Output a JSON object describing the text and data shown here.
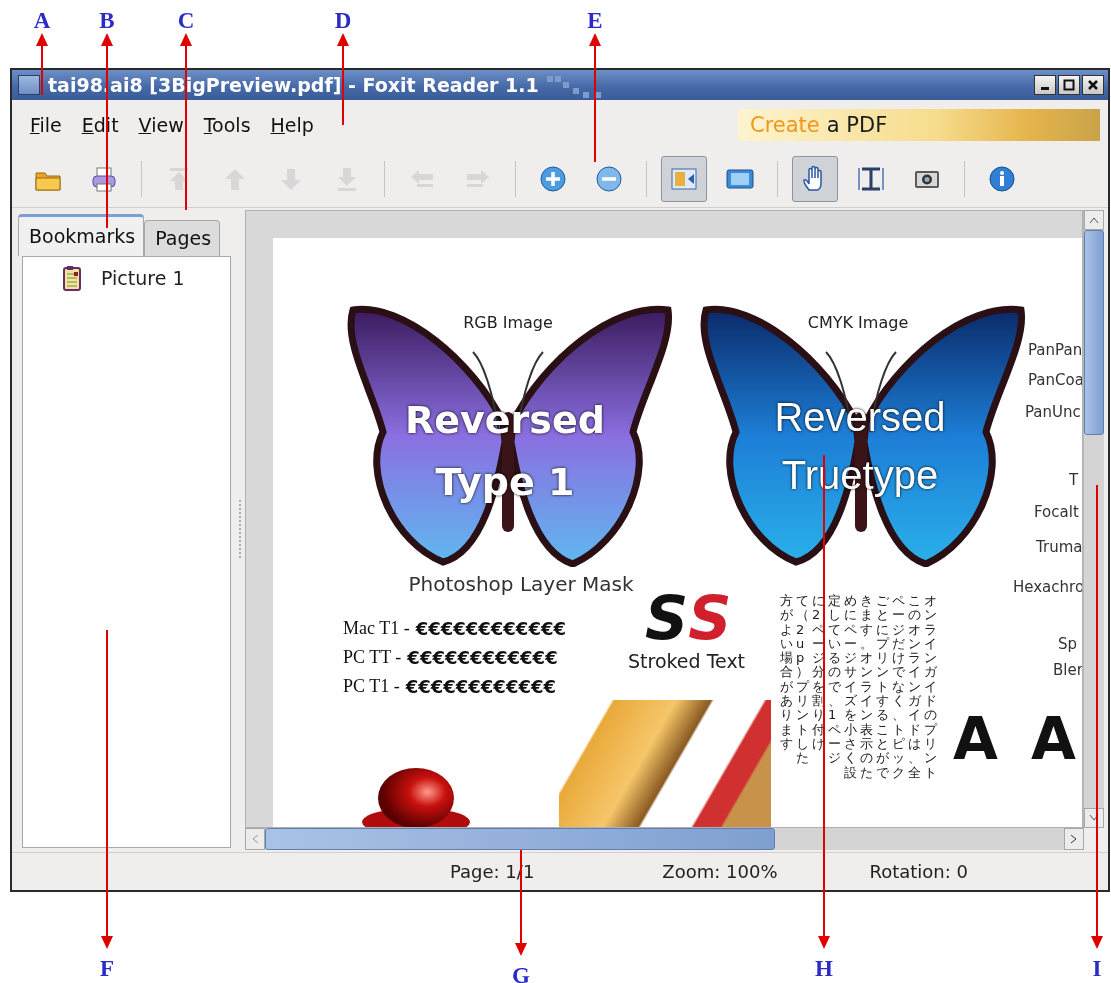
{
  "window": {
    "title": "tai98.ai8 [3BigPreview.pdf] - Foxit Reader 1.1"
  },
  "menu": [
    "File",
    "Edit",
    "View",
    "Tools",
    "Help"
  ],
  "banner": {
    "highlight": "Create",
    "text": "a PDF"
  },
  "toolbar": [
    {
      "disabled": false,
      "pressed": false
    },
    {
      "disabled": false,
      "pressed": false
    },
    {
      "disabled": true,
      "pressed": false
    },
    {
      "disabled": true,
      "pressed": false
    },
    {
      "disabled": true,
      "pressed": false
    },
    {
      "disabled": true,
      "pressed": false
    },
    {
      "disabled": true,
      "pressed": false
    },
    {
      "disabled": true,
      "pressed": false
    },
    {
      "disabled": false,
      "pressed": false
    },
    {
      "disabled": false,
      "pressed": false
    },
    {
      "disabled": false,
      "pressed": true
    },
    {
      "disabled": false,
      "pressed": false
    },
    {
      "disabled": false,
      "pressed": true
    },
    {
      "disabled": false,
      "pressed": false
    },
    {
      "disabled": false,
      "pressed": false
    },
    {
      "disabled": false,
      "pressed": false
    }
  ],
  "tabs": [
    {
      "label": "Bookmarks",
      "selected": true
    },
    {
      "label": "Pages",
      "selected": false
    }
  ],
  "bookmarks": [
    {
      "label": "Picture 1"
    }
  ],
  "document": {
    "rgb_image": {
      "caption": "RGB Image",
      "overlay": [
        "Reversed",
        "Type 1"
      ]
    },
    "cmyk_image": {
      "caption": "CMYK Image",
      "overlay": [
        "Reversed",
        "Truetype"
      ]
    },
    "mask_caption": "Photoshop Layer Mask",
    "euro_rows": [
      {
        "label": "Mac T1 -",
        "sample": "€€€€€€€€€€€€"
      },
      {
        "label": "PC TT -",
        "sample": "€€€€€€€€€€€€"
      },
      {
        "label": "PC T1 -",
        "sample": "€€€€€€€€€€€€"
      }
    ],
    "stroked": {
      "letters": [
        {
          "letter": "S",
          "color": "#111111"
        },
        {
          "letter": "S",
          "color": "#d0202e"
        }
      ],
      "caption": "Stroked Text"
    },
    "japanese_columns": [
      "方がよい場合があります",
      "て（2 up）プリントした",
      "に 2 ページ分を割り付け",
      "定しているので、1ページ",
      "めにページサイズを小さく設",
      "きます。オンライン表示のた",
      "ごとにプリントすることがで",
      "ページだけでなく、トピック",
      "このオンラインガイドは、全",
      "オンラインガイドのプリント"
    ],
    "side_labels": [
      "PanPan",
      "PanCoa",
      "PanUnc",
      "T",
      "Focalt",
      "Truma",
      "Hexachro",
      "Sp",
      "Bler"
    ],
    "big_letters": [
      "A",
      "A"
    ]
  },
  "status_bar": {
    "page": "Page: 1/1",
    "zoom": "Zoom: 100%",
    "rotation": "Rotation: 0"
  },
  "callouts": [
    {
      "letter": "A"
    },
    {
      "letter": "B"
    },
    {
      "letter": "C"
    },
    {
      "letter": "D"
    },
    {
      "letter": "E"
    },
    {
      "letter": "F"
    },
    {
      "letter": "G"
    },
    {
      "letter": "H"
    },
    {
      "letter": "I"
    }
  ]
}
